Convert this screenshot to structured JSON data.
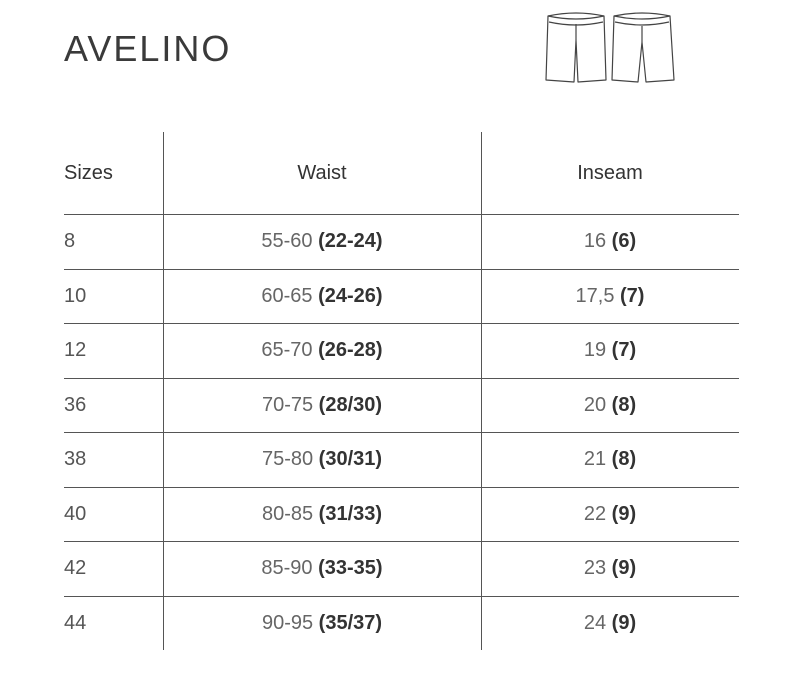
{
  "brand": "AVELINO",
  "table": {
    "headers": {
      "sizes": "Sizes",
      "waist": "Waist",
      "inseam": "Inseam"
    },
    "rows": [
      {
        "size": "8",
        "waist_cm": "55-60",
        "waist_in": "(22-24)",
        "inseam_cm": "16",
        "inseam_in": "(6)"
      },
      {
        "size": "10",
        "waist_cm": "60-65",
        "waist_in": "(24-26)",
        "inseam_cm": "17,5",
        "inseam_in": "(7)"
      },
      {
        "size": "12",
        "waist_cm": "65-70",
        "waist_in": "(26-28)",
        "inseam_cm": "19",
        "inseam_in": "(7)"
      },
      {
        "size": "36",
        "waist_cm": "70-75",
        "waist_in": "(28/30)",
        "inseam_cm": "20",
        "inseam_in": "(8)"
      },
      {
        "size": "38",
        "waist_cm": "75-80",
        "waist_in": "(30/31)",
        "inseam_cm": "21",
        "inseam_in": "(8)"
      },
      {
        "size": "40",
        "waist_cm": "80-85",
        "waist_in": "(31/33)",
        "inseam_cm": "22",
        "inseam_in": "(9)"
      },
      {
        "size": "42",
        "waist_cm": "85-90",
        "waist_in": "(33-35)",
        "inseam_cm": "23",
        "inseam_in": "(9)"
      },
      {
        "size": "44",
        "waist_cm": "90-95",
        "waist_in": "(35/37)",
        "inseam_cm": "24",
        "inseam_in": "(9)"
      }
    ]
  },
  "icons": {
    "garment": "shorts-front-back-icon"
  }
}
